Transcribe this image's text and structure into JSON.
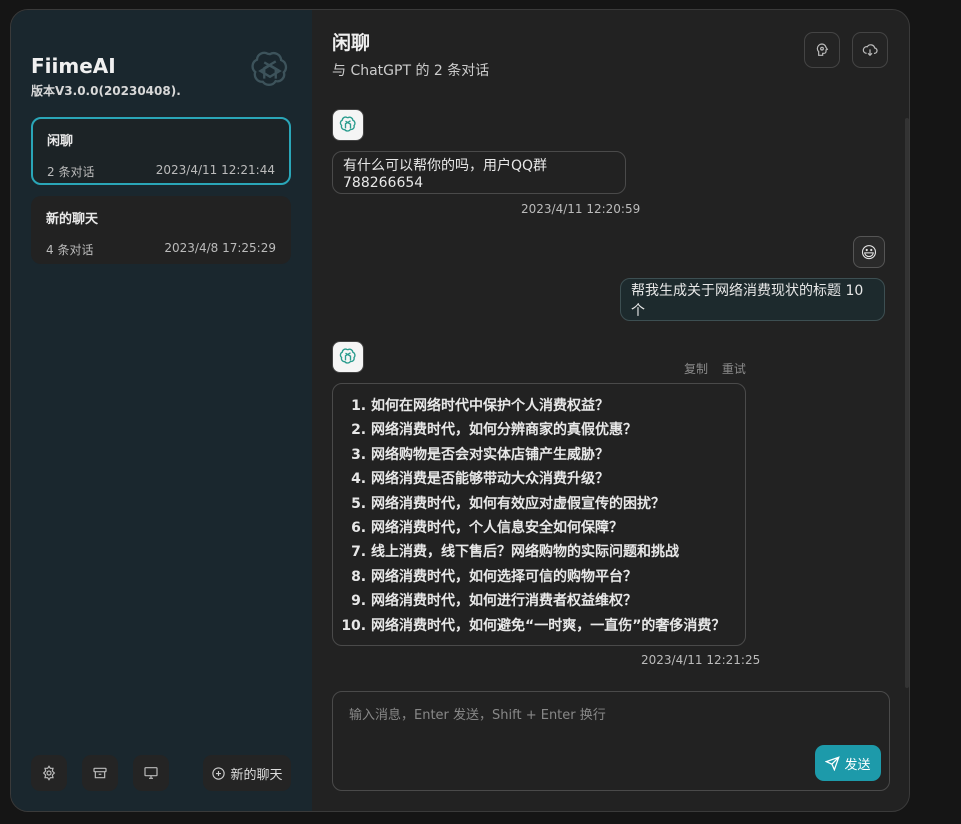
{
  "sidebar": {
    "app_name": "FiimeAI",
    "version": "版本V3.0.0(20230408).",
    "sessions": [
      {
        "title": "闲聊",
        "count": "2 条对话",
        "time": "2023/4/11 12:21:44"
      },
      {
        "title": "新的聊天",
        "count": "4 条对话",
        "time": "2023/4/8 17:25:29"
      }
    ],
    "new_chat_label": "新的聊天"
  },
  "chat": {
    "title": "闲聊",
    "subtitle": "与 ChatGPT 的 2 条对话",
    "messages": [
      {
        "role": "bot",
        "text": "有什么可以帮你的吗，用户QQ群788266654",
        "time": "2023/4/11 12:20:59"
      },
      {
        "role": "user",
        "avatar": "😃",
        "text": "帮我生成关于网络消费现状的标题 10个"
      },
      {
        "role": "bot",
        "time": "2023/4/11 12:21:25",
        "actions": {
          "copy": "复制",
          "retry": "重试"
        },
        "items": [
          "如何在网络时代中保护个人消费权益？",
          "网络消费时代，如何分辨商家的真假优惠？",
          "网络购物是否会对实体店铺产生威胁？",
          "网络消费是否能够带动大众消费升级？",
          "网络消费时代，如何有效应对虚假宣传的困扰？",
          "网络消费时代，个人信息安全如何保障？",
          "线上消费，线下售后？网络购物的实际问题和挑战",
          "网络消费时代，如何选择可信的购物平台？",
          "网络消费时代，如何进行消费者权益维权？",
          "网络消费时代，如何避免“一时爽，一直伤”的奢侈消费？"
        ]
      }
    ]
  },
  "input": {
    "placeholder": "输入消息，Enter 发送，Shift + Enter 换行",
    "send_label": "发送"
  },
  "colors": {
    "accent": "#1d9aaa",
    "active_border": "#2aa6b8",
    "sidebar_bg": "#1a272e"
  },
  "icons": {
    "brand": "openai-logo-icon",
    "settings": "settings-icon",
    "store": "store-icon",
    "desktop": "monitor-icon",
    "new_chat": "plus-circle-icon",
    "prompt": "brain-icon",
    "export": "cloud-download-icon",
    "send": "paper-plane-icon"
  }
}
